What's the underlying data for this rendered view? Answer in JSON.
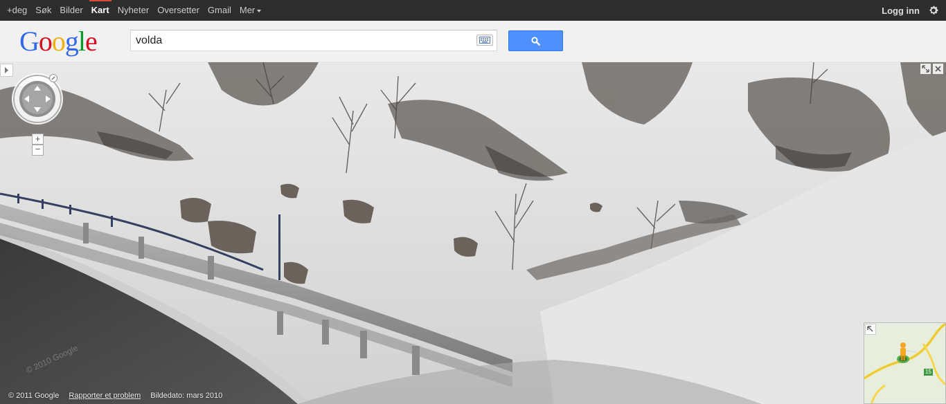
{
  "topnav": {
    "items": [
      {
        "label": "+deg",
        "active": false
      },
      {
        "label": "Søk",
        "active": false
      },
      {
        "label": "Bilder",
        "active": false
      },
      {
        "label": "Kart",
        "active": true
      },
      {
        "label": "Nyheter",
        "active": false
      },
      {
        "label": "Oversetter",
        "active": false
      },
      {
        "label": "Gmail",
        "active": false
      },
      {
        "label": "Mer",
        "active": false
      }
    ],
    "login_label": "Logg inn",
    "settings_icon": "gear-icon"
  },
  "header": {
    "logo_letters": [
      "G",
      "o",
      "o",
      "g",
      "l",
      "e"
    ],
    "search_value": "volda",
    "keyboard_icon": "keyboard-icon",
    "search_icon": "magnifier-icon"
  },
  "panorama": {
    "zoom_in_label": "+",
    "zoom_out_label": "−",
    "copyright": "© 2011 Google",
    "report_link": "Rapporter et problem",
    "image_date": "Bildedato: mars 2010",
    "watermark": "© 2010 Google"
  },
  "minimap": {
    "road_label": "15"
  },
  "colors": {
    "topbar": "#2d2d2d",
    "active_accent": "#dd4b39",
    "search_button": "#4d90fe",
    "road_yellow": "#f6d64a",
    "map_bg": "#e8eedd"
  }
}
